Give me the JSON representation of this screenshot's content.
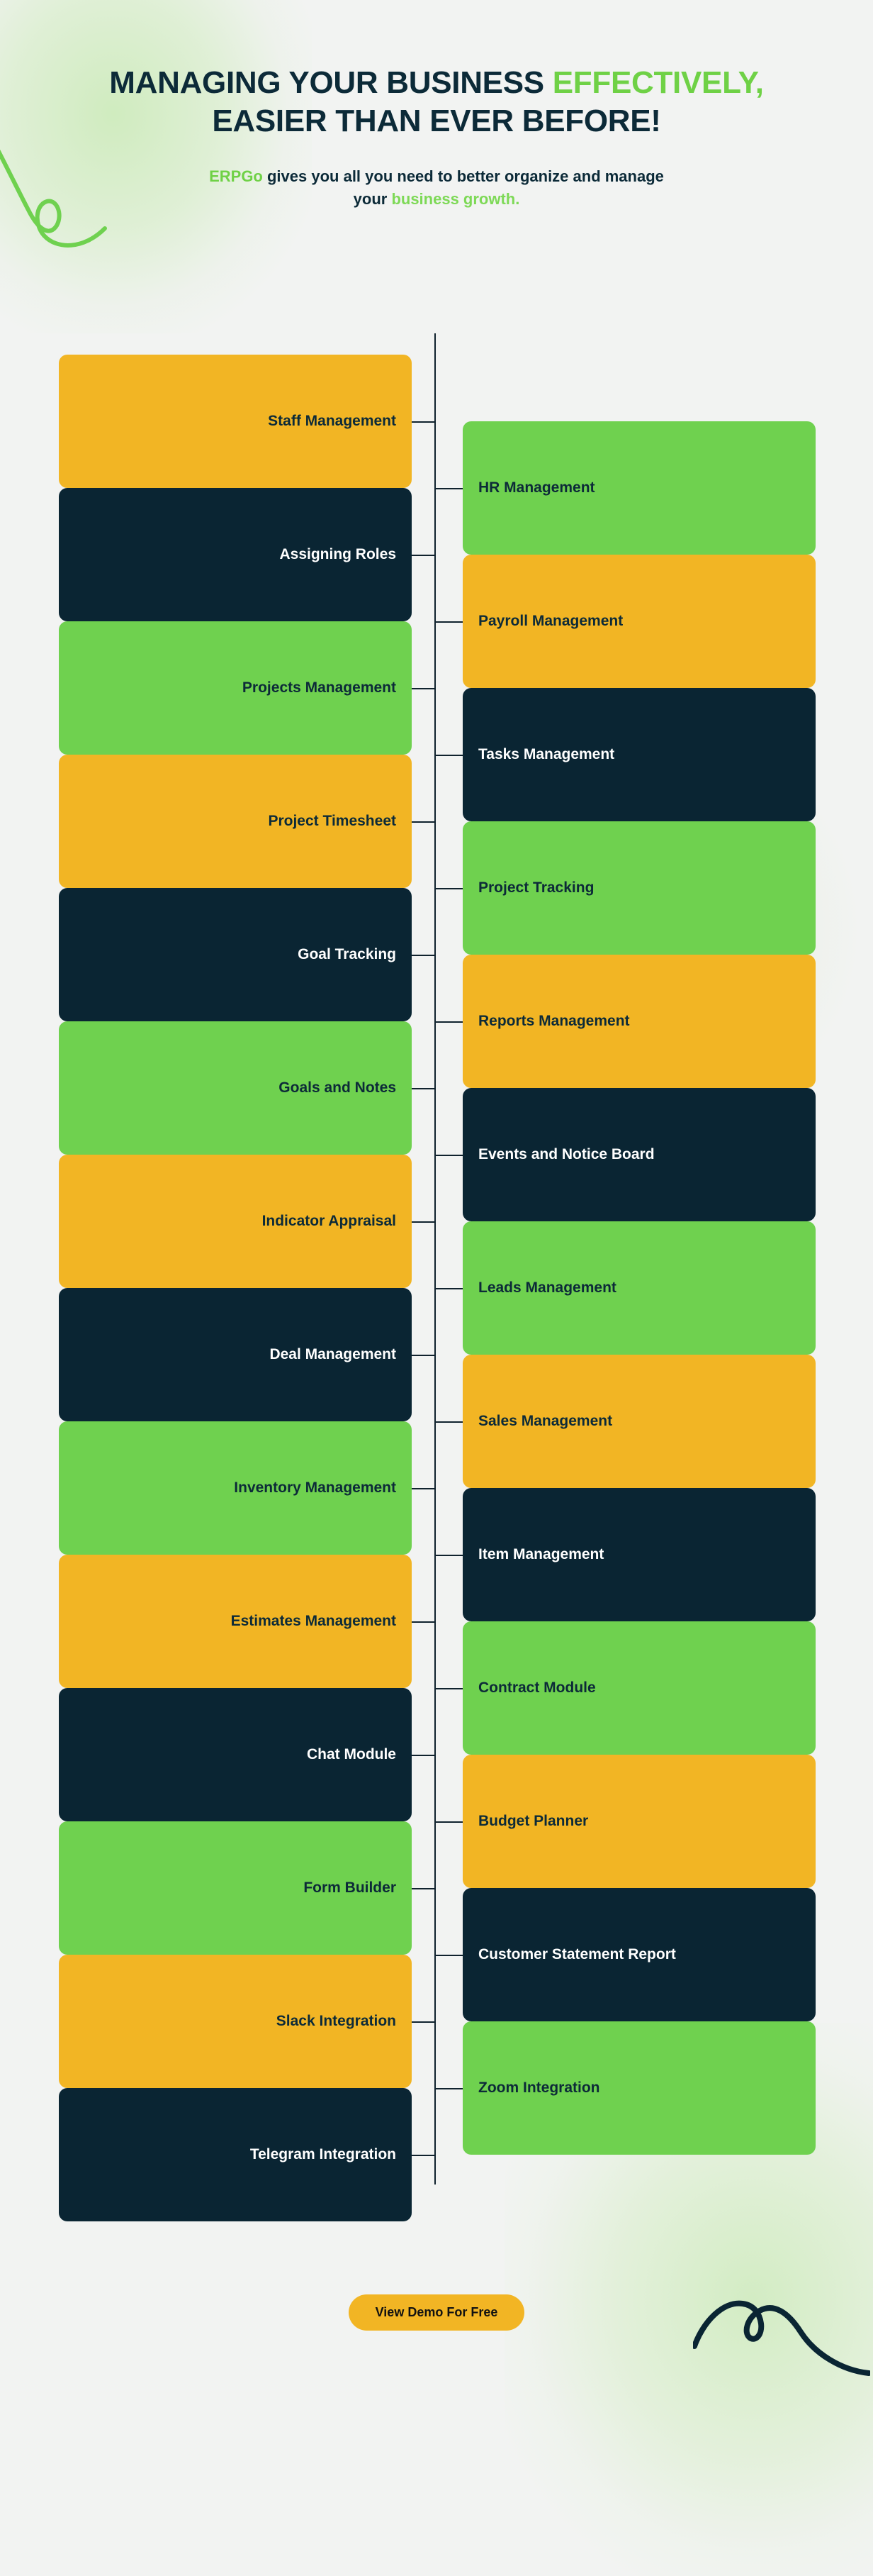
{
  "header": {
    "headline_part1": "MANAGING YOUR BUSINESS ",
    "headline_accent": "EFFECTIVELY,",
    "headline_line2": "EASIER THAN EVER BEFORE!",
    "sub_brand": "ERPGo",
    "sub_part1": " gives you all you need to better organize and manage your ",
    "sub_accent": "business growth."
  },
  "colors": {
    "background": "#f2f3f2",
    "amber": "#f2b524",
    "navy": "#0a2533",
    "green": "#6fd14f",
    "accent_green": "#6fd146",
    "line": "#10222e",
    "text_dark": "#0c2a38",
    "text_light": "#ffffff"
  },
  "diagram": {
    "left_column": [
      {
        "label": "Staff Management",
        "color": "amber"
      },
      {
        "label": "Assigning Roles",
        "color": "navy"
      },
      {
        "label": "Projects Management",
        "color": "green"
      },
      {
        "label": "Project Timesheet",
        "color": "amber"
      },
      {
        "label": "Goal Tracking",
        "color": "navy"
      },
      {
        "label": "Goals and Notes",
        "color": "green"
      },
      {
        "label": "Indicator Appraisal",
        "color": "amber"
      },
      {
        "label": "Deal Management",
        "color": "navy"
      },
      {
        "label": "Inventory Management",
        "color": "green"
      },
      {
        "label": "Estimates Management",
        "color": "amber"
      },
      {
        "label": "Chat Module",
        "color": "navy"
      },
      {
        "label": "Form Builder",
        "color": "green"
      },
      {
        "label": "Slack Integration",
        "color": "amber"
      },
      {
        "label": "Telegram Integration",
        "color": "navy"
      }
    ],
    "right_column": [
      {
        "label": "HR Management",
        "color": "green"
      },
      {
        "label": "Payroll Management",
        "color": "amber"
      },
      {
        "label": "Tasks Management",
        "color": "navy"
      },
      {
        "label": "Project Tracking",
        "color": "green"
      },
      {
        "label": "Reports Management",
        "color": "amber"
      },
      {
        "label": "Events and Notice Board",
        "color": "navy"
      },
      {
        "label": "Leads Management",
        "color": "green"
      },
      {
        "label": "Sales Management",
        "color": "amber"
      },
      {
        "label": "Item Management",
        "color": "navy"
      },
      {
        "label": "Contract Module",
        "color": "green"
      },
      {
        "label": "Budget Planner",
        "color": "amber"
      },
      {
        "label": "Customer Statement Report",
        "color": "navy"
      },
      {
        "label": "Zoom Integration",
        "color": "green"
      }
    ]
  },
  "cta": {
    "label": "View Demo For Free"
  },
  "icons": {
    "swirl_top_left": "green-swirl-icon",
    "swirl_bottom_right": "navy-swirl-icon"
  }
}
